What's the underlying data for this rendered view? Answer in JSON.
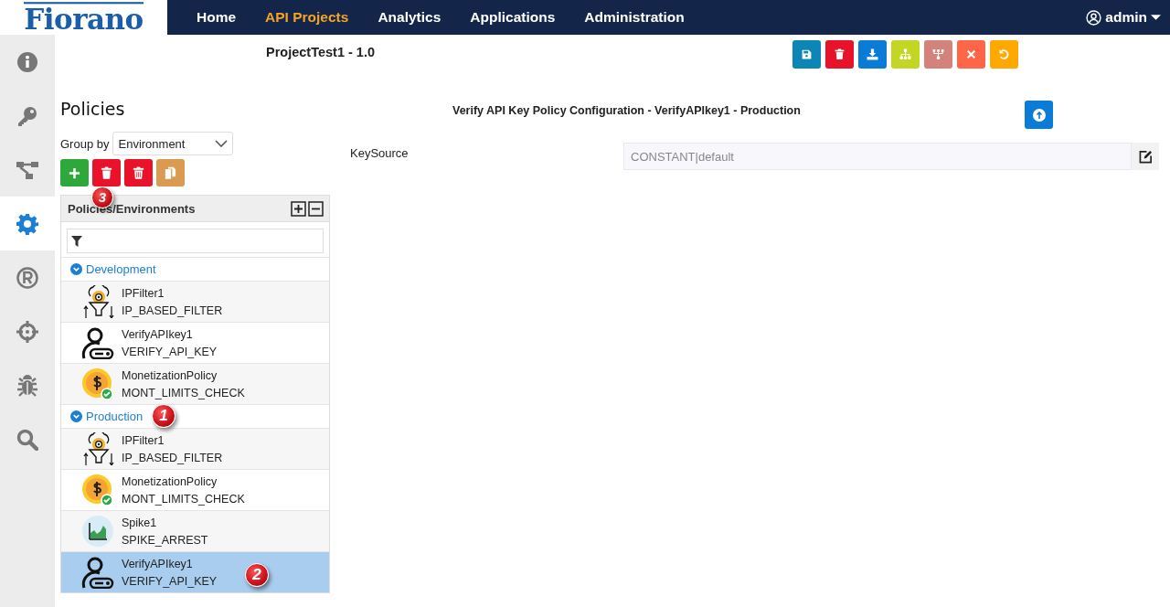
{
  "nav": {
    "logo": "Fiorano",
    "items": [
      {
        "label": "Home",
        "selected": false
      },
      {
        "label": "API Projects",
        "selected": true
      },
      {
        "label": "Analytics",
        "selected": false
      },
      {
        "label": "Applications",
        "selected": false
      },
      {
        "label": "Administration",
        "selected": false
      }
    ],
    "user": "admin"
  },
  "sidebar": {
    "items": [
      {
        "kind": "info",
        "selected": false
      },
      {
        "kind": "key",
        "selected": false
      },
      {
        "kind": "flow",
        "selected": false
      },
      {
        "kind": "gear",
        "selected": true
      },
      {
        "kind": "registered",
        "selected": false
      },
      {
        "kind": "crosshair",
        "selected": false
      },
      {
        "kind": "bug",
        "selected": false
      },
      {
        "kind": "search",
        "selected": false
      }
    ]
  },
  "project_title": "ProjectTest1 - 1.0",
  "toolbar": [
    {
      "kind": "save"
    },
    {
      "kind": "delete"
    },
    {
      "kind": "download"
    },
    {
      "kind": "hierarchy"
    },
    {
      "kind": "tree"
    },
    {
      "kind": "close"
    },
    {
      "kind": "undo"
    }
  ],
  "policies": {
    "heading": "Policies",
    "group_by_label": "Group by",
    "group_by_value": "Environment",
    "actions": [
      {
        "kind": "add"
      },
      {
        "kind": "delete",
        "callout": "3"
      },
      {
        "kind": "delete-all"
      },
      {
        "kind": "copy"
      }
    ],
    "tree": {
      "header": "Policies/Environments",
      "groups": [
        {
          "label": "Development",
          "expanded": true,
          "children": [
            {
              "name": "IPFilter1",
              "type": "IP_BASED_FILTER",
              "kind": "ip_filter",
              "selected": false
            },
            {
              "name": "VerifyAPIkey1",
              "type": "VERIFY_API_KEY",
              "kind": "verify_key",
              "selected": false
            },
            {
              "name": "MonetizationPolicy",
              "type": "MONT_LIMITS_CHECK",
              "kind": "monetization",
              "selected": false
            }
          ]
        },
        {
          "label": "Production",
          "expanded": true,
          "callout": "1",
          "children": [
            {
              "name": "IPFilter1",
              "type": "IP_BASED_FILTER",
              "kind": "ip_filter",
              "selected": false
            },
            {
              "name": "MonetizationPolicy",
              "type": "MONT_LIMITS_CHECK",
              "kind": "monetization",
              "selected": false
            },
            {
              "name": "Spike1",
              "type": "SPIKE_ARREST",
              "kind": "spike",
              "selected": false
            },
            {
              "name": "VerifyAPIkey1",
              "type": "VERIFY_API_KEY",
              "kind": "verify_key",
              "selected": true,
              "callout": "2"
            }
          ]
        }
      ]
    }
  },
  "config": {
    "title": "Verify API Key Policy Configuration - VerifyAPIkey1 - Production",
    "fields": [
      {
        "label": "KeySource",
        "value": "CONSTANT|default"
      }
    ]
  }
}
